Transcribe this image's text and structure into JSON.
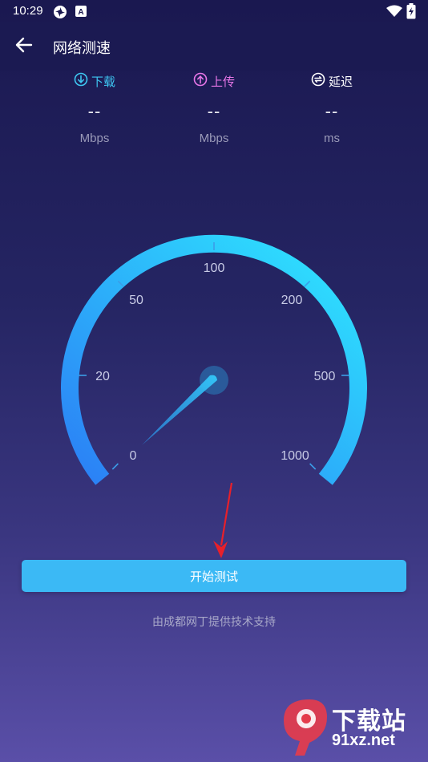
{
  "status_bar": {
    "time": "10:29",
    "icons": [
      "pinwheel-icon",
      "a-badge-icon",
      "wifi-icon",
      "battery-charging-icon"
    ]
  },
  "app_bar": {
    "title": "网络测速",
    "back_icon": "arrow-left-icon"
  },
  "metrics": [
    {
      "key": "download",
      "label": "下载",
      "value": "--",
      "unit": "Mbps",
      "color": "#3ec7f2",
      "icon": "download-circle-icon"
    },
    {
      "key": "upload",
      "label": "上传",
      "value": "--",
      "unit": "Mbps",
      "color": "#e877e8",
      "icon": "upload-circle-icon"
    },
    {
      "key": "latency",
      "label": "延迟",
      "value": "--",
      "unit": "ms",
      "color": "#ffffff",
      "icon": "refresh-circle-icon"
    }
  ],
  "gauge": {
    "labels": [
      "0",
      "20",
      "50",
      "100",
      "200",
      "500",
      "1000"
    ],
    "gradient_start": "#2b7ef5",
    "gradient_end": "#2ee8ff",
    "needle_color": "#2a9ee8"
  },
  "start_button": {
    "label": "开始测试"
  },
  "credit": "由成都网丁提供技术支持",
  "watermark": {
    "text": "下载站",
    "domain": "91xz.net"
  }
}
